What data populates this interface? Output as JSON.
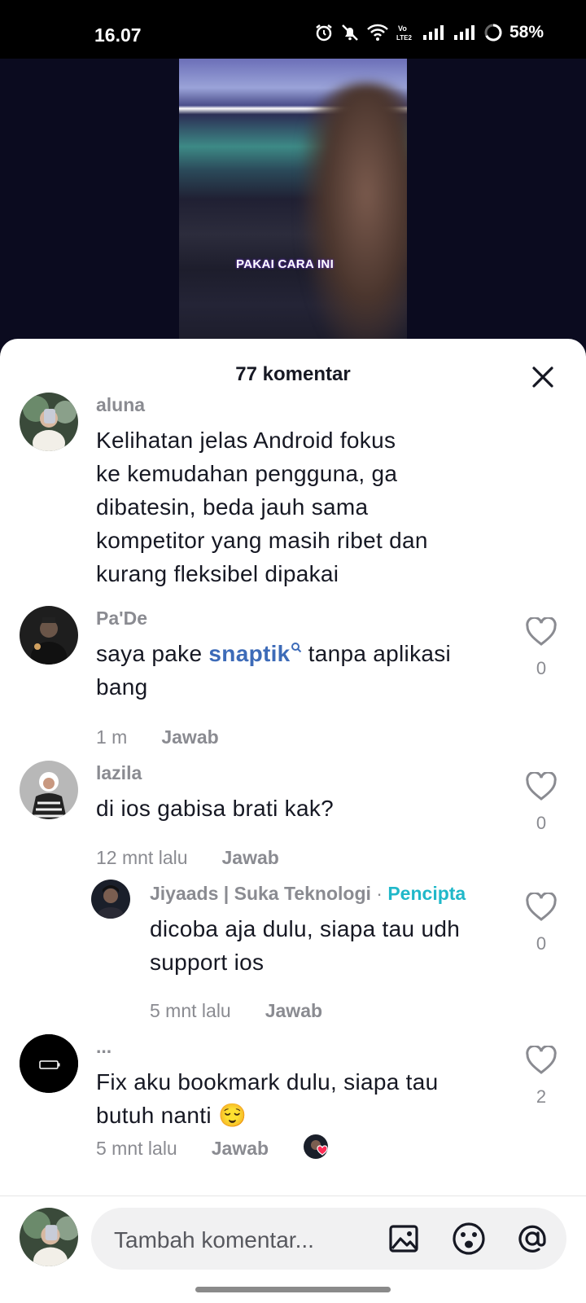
{
  "status_bar": {
    "time": "16.07",
    "battery": "58%",
    "icons": [
      "alarm-icon",
      "mute-icon",
      "wifi-icon",
      "volte-icon",
      "signal-icon",
      "signal-icon",
      "battery-icon"
    ]
  },
  "video": {
    "caption": "PAKAI CARA INI"
  },
  "comments_sheet": {
    "title": "77 komentar",
    "comments": [
      {
        "username": "aluna",
        "lines": [
          "Kelihatan jelas Android fokus",
          "ke kemudahan pengguna, ga",
          "dibatesin, beda jauh sama",
          "kompetitor yang masih ribet dan",
          "kurang fleksibel dipakai"
        ]
      },
      {
        "username": "Pa'De",
        "text_before": "saya pake ",
        "link": "snaptik",
        "text_after": " tanpa aplikasi",
        "line2": "bang",
        "time": "1 m",
        "reply": "Jawab",
        "likes": "0"
      },
      {
        "username": "lazila",
        "text": "di ios gabisa brati kak?",
        "time": "12 mnt lalu",
        "reply": "Jawab",
        "likes": "0"
      },
      {
        "username": "Jiyaads | Suka Teknologi",
        "separator": "·",
        "creator_label": "Pencipta",
        "lines": [
          "dicoba aja dulu, siapa tau udh",
          "support ios"
        ],
        "time": "5 mnt lalu",
        "reply": "Jawab",
        "likes": "0"
      },
      {
        "username": "...",
        "lines": [
          "Fix aku bookmark dulu, siapa tau",
          "butuh nanti 😌"
        ],
        "time": "5 mnt lalu",
        "reply": "Jawab",
        "likes": "2"
      }
    ]
  },
  "composer": {
    "placeholder": "Tambah komentar..."
  },
  "colors": {
    "creator_accent": "#20b8c9",
    "link": "#3d6bb8",
    "like_heart": "#fe2c55"
  }
}
